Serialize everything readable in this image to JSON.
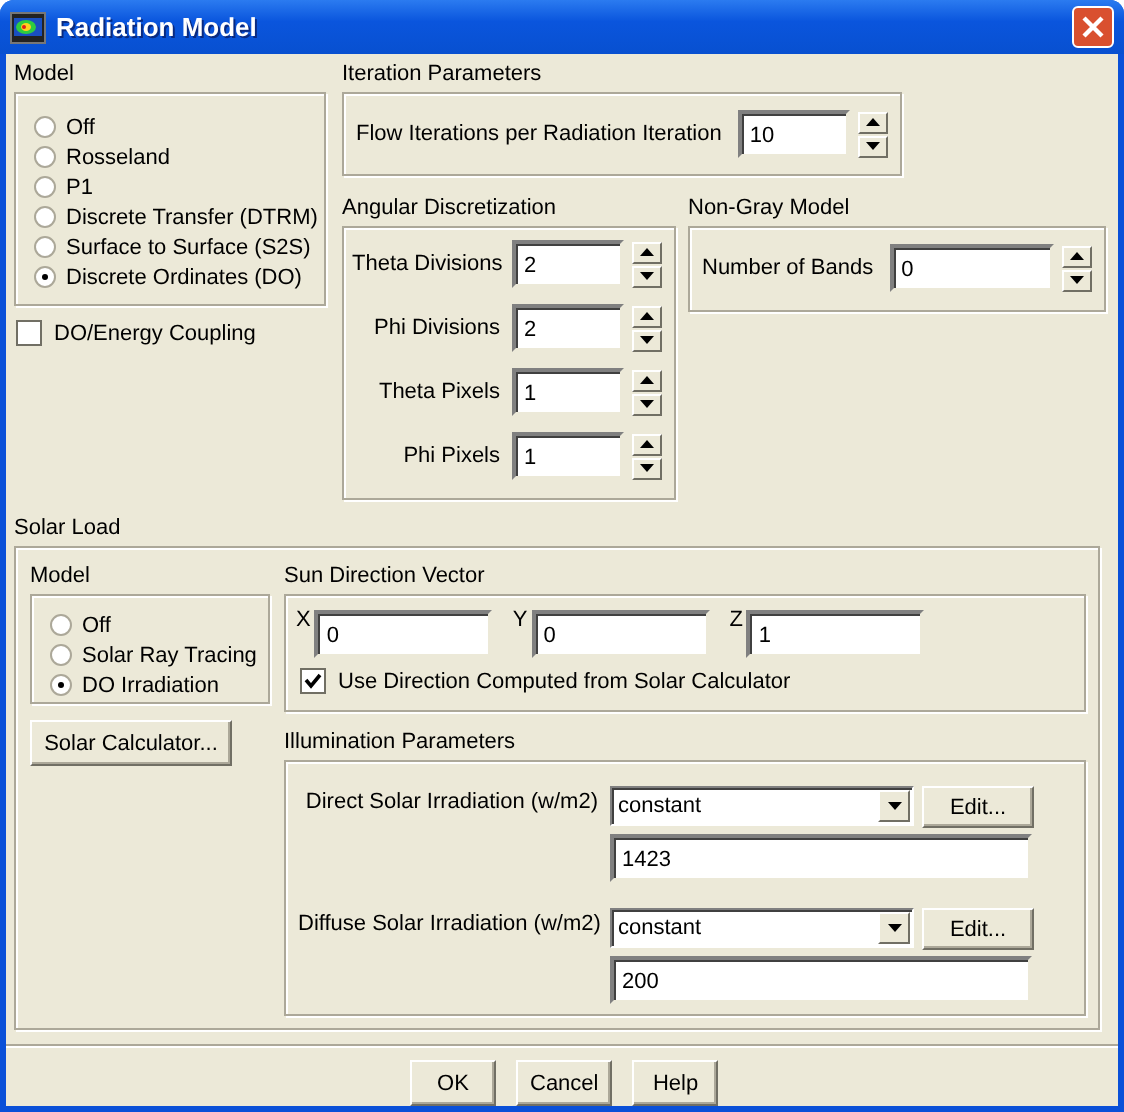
{
  "window": {
    "title": "Radiation Model"
  },
  "model": {
    "title": "Model",
    "options": [
      {
        "label": "Off",
        "selected": false
      },
      {
        "label": "Rosseland",
        "selected": false
      },
      {
        "label": "P1",
        "selected": false
      },
      {
        "label": "Discrete Transfer (DTRM)",
        "selected": false
      },
      {
        "label": "Surface to Surface (S2S)",
        "selected": false
      },
      {
        "label": "Discrete Ordinates (DO)",
        "selected": true
      }
    ]
  },
  "do_energy_coupling": {
    "label": "DO/Energy Coupling",
    "checked": false
  },
  "iteration_parameters": {
    "title": "Iteration Parameters",
    "fields": [
      {
        "label": "Flow Iterations per Radiation Iteration",
        "value": "10"
      }
    ]
  },
  "angular_discretization": {
    "title": "Angular Discretization",
    "fields": [
      {
        "label": "Theta Divisions",
        "value": "2"
      },
      {
        "label": "Phi Divisions",
        "value": "2"
      },
      {
        "label": "Theta Pixels",
        "value": "1"
      },
      {
        "label": "Phi Pixels",
        "value": "1"
      }
    ]
  },
  "non_gray_model": {
    "title": "Non-Gray Model",
    "fields": [
      {
        "label": "Number of Bands",
        "value": "0"
      }
    ]
  },
  "solar_load": {
    "title": "Solar Load",
    "model": {
      "title": "Model",
      "options": [
        {
          "label": "Off",
          "selected": false
        },
        {
          "label": "Solar Ray Tracing",
          "selected": false
        },
        {
          "label": "DO Irradiation",
          "selected": true
        }
      ]
    },
    "solar_calculator_button": "Solar Calculator...",
    "sun_direction_vector": {
      "title": "Sun Direction Vector",
      "components": [
        {
          "label": "X",
          "value": "0"
        },
        {
          "label": "Y",
          "value": "0"
        },
        {
          "label": "Z",
          "value": "1"
        }
      ],
      "use_computed": {
        "label": "Use Direction Computed from Solar Calculator",
        "checked": true
      }
    },
    "illumination_parameters": {
      "title": "Illumination Parameters",
      "rows": [
        {
          "label": "Direct Solar Irradiation (w/m2)",
          "method": "constant",
          "edit_button": "Edit...",
          "value": "1423"
        },
        {
          "label": "Diffuse Solar Irradiation (w/m2)",
          "method": "constant",
          "edit_button": "Edit...",
          "value": "200"
        }
      ]
    }
  },
  "buttons": [
    "OK",
    "Cancel",
    "Help"
  ]
}
